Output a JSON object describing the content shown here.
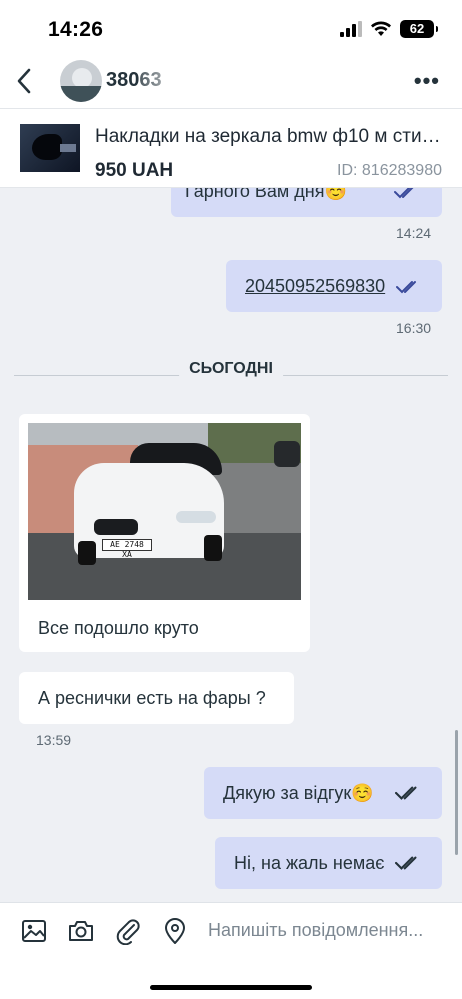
{
  "status_bar": {
    "time": "14:26",
    "battery": "62"
  },
  "header": {
    "contact_name": "38063"
  },
  "listing": {
    "title": "Накладки на зеркала bmw ф10 м стил...",
    "price": "950 UAH",
    "id": "ID: 816283980"
  },
  "messages": [
    {
      "text": "Гарного Вам дня☺️",
      "time": "14:24",
      "direction": "outgoing",
      "read": true
    },
    {
      "text": "20450952569830",
      "time": "16:30",
      "direction": "outgoing",
      "read": true,
      "link": true
    }
  ],
  "day_separator": "СЬОГОДНІ",
  "incoming": {
    "photo_plate": "AE 2748 XA",
    "photo_caption": "Все подошло круто",
    "question": "А реснички есть на фары ?",
    "question_time": "13:59"
  },
  "replies": [
    {
      "text": "Дякую за відгук☺️",
      "direction": "outgoing",
      "read": true
    },
    {
      "text": "Ні, на жаль немає",
      "direction": "outgoing",
      "read": true
    }
  ],
  "composer": {
    "placeholder": "Напишіть повідомлення...",
    "icons": [
      "image-icon",
      "camera-icon",
      "paperclip-icon",
      "location-pin-icon"
    ]
  },
  "colors": {
    "outgoing_bubble": "#d5dbf7",
    "incoming_bubble": "#ffffff",
    "chat_background": "#eef0f4",
    "check_color": "#3a4a9b"
  }
}
